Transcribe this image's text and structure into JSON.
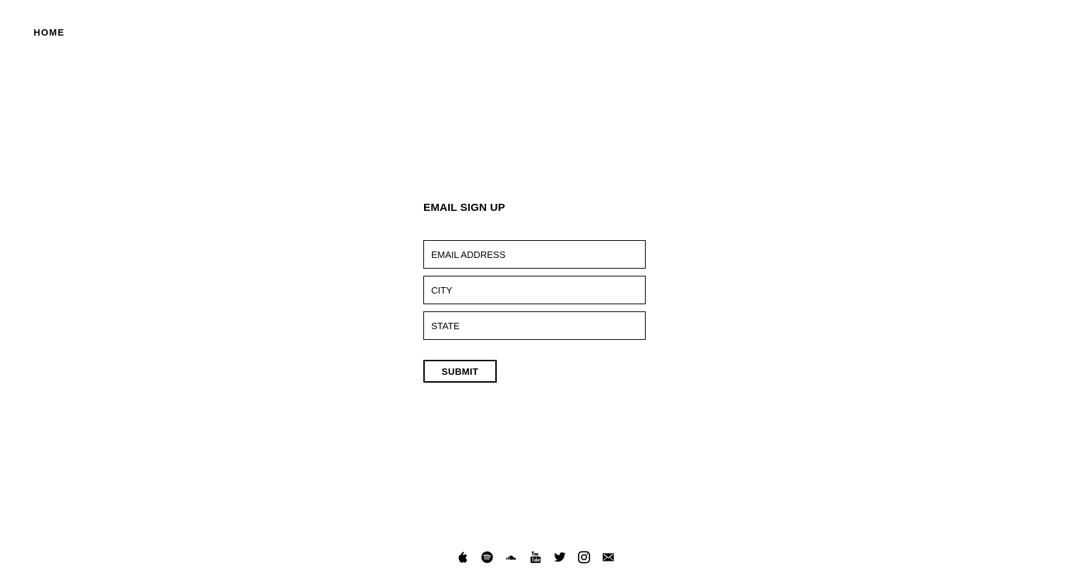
{
  "nav": {
    "home_label": "HOME"
  },
  "signup": {
    "title": "EMAIL SIGN UP",
    "email_placeholder": "EMAIL ADDRESS",
    "city_placeholder": "CITY",
    "state_placeholder": "STATE",
    "submit_label": "SUBMIT"
  },
  "social": {
    "icons": [
      "apple-icon",
      "spotify-icon",
      "soundcloud-icon",
      "youtube-icon",
      "twitter-icon",
      "instagram-icon",
      "email-icon"
    ]
  },
  "colors": {
    "background": "#ffffff",
    "foreground": "#000000"
  }
}
